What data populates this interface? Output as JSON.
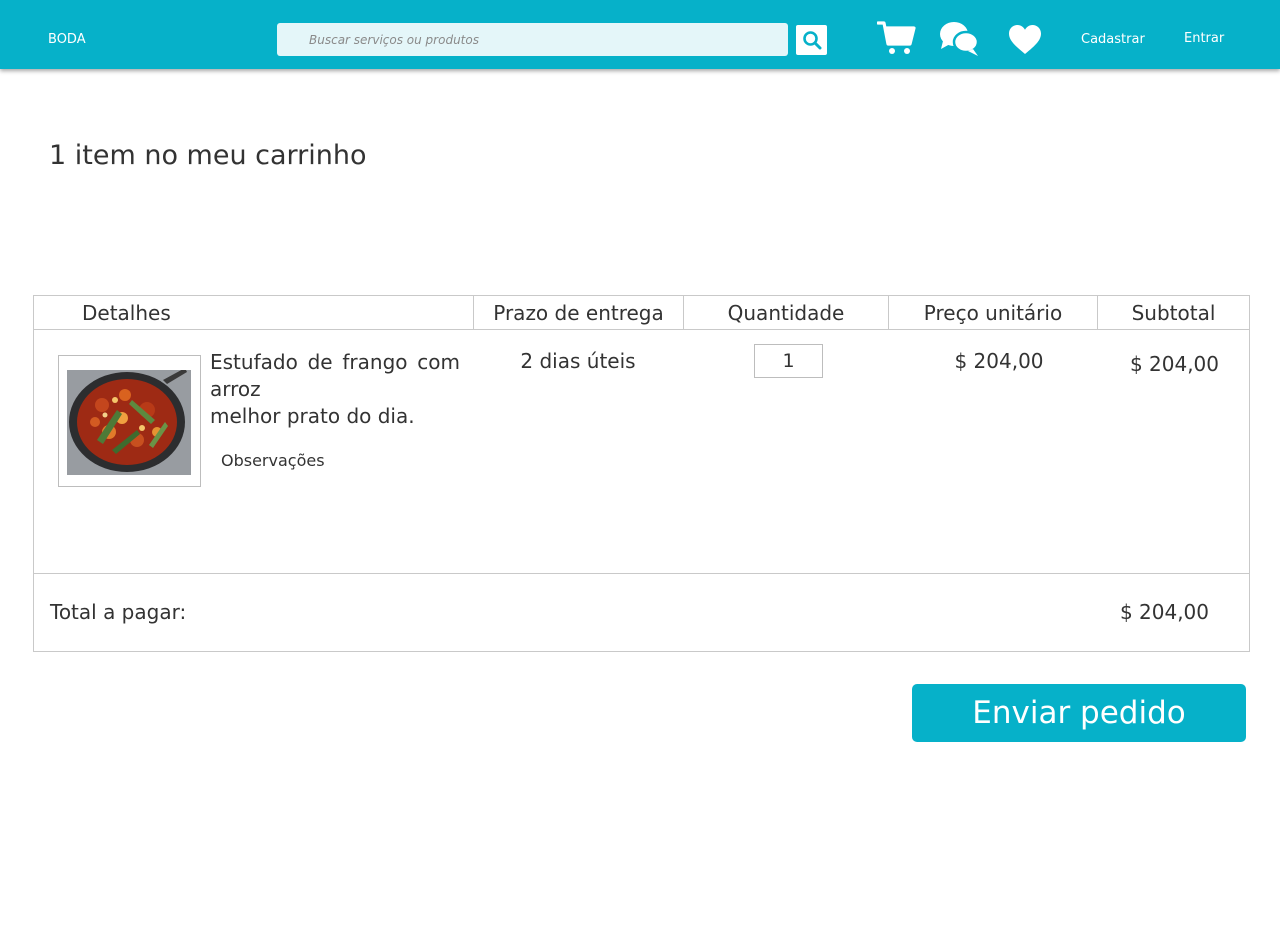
{
  "header": {
    "brand": "BODA",
    "search_placeholder": "Buscar serviços ou produtos",
    "links": {
      "signup": "Cadastrar",
      "login": "Entrar"
    }
  },
  "icons": {
    "search": "search-icon",
    "cart": "cart-icon",
    "chat": "chat-icon",
    "favorites": "heart-icon"
  },
  "cart": {
    "title": "1 item no meu carrinho",
    "columns": [
      "Detalhes",
      "Prazo de entrega",
      "Quantidade",
      "Preço unitário",
      "Subtotal"
    ],
    "items": [
      {
        "name_line1": "Estufado de frango com",
        "name_line2": "arroz",
        "name_line3": "melhor prato do dia.",
        "notes_label": "Observações",
        "delivery": "2 dias úteis",
        "quantity": "1",
        "unit_price": "$ 204,00",
        "subtotal": "$ 204,00"
      }
    ],
    "total_label": "Total a pagar:",
    "total_value": "$ 204,00"
  },
  "actions": {
    "submit": "Enviar pedido"
  },
  "colors": {
    "brand": "#06b1c9",
    "search_bg": "#e4f6f9",
    "border": "#c9c9c9",
    "text": "#333333"
  }
}
